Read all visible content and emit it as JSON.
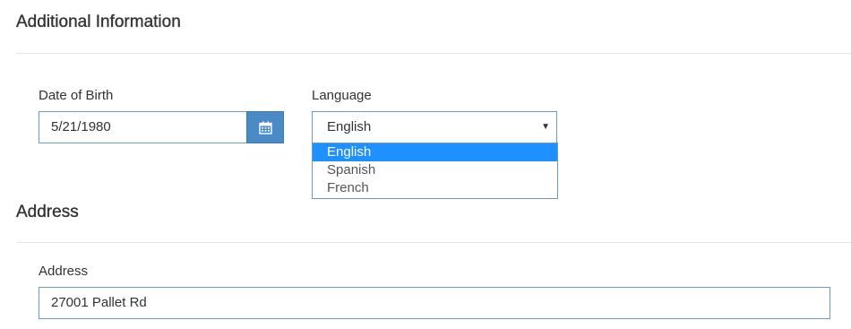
{
  "sections": {
    "additional_info_title": "Additional Information",
    "address_title": "Address"
  },
  "fields": {
    "dob": {
      "label": "Date of Birth",
      "value": "5/21/1980",
      "button_icon": "calendar-icon"
    },
    "language": {
      "label": "Language",
      "value": "English",
      "arrow_icon": "caret-down-icon",
      "arrow_glyph": "▼",
      "options": [
        "English",
        "Spanish",
        "French"
      ],
      "selected_option": "English"
    },
    "address": {
      "label": "Address",
      "value": "27001 Pallet Rd"
    }
  },
  "colors": {
    "accent": "#4a8ac6",
    "input_border": "#6a9cc6",
    "option_highlight": "#1e90ff"
  }
}
